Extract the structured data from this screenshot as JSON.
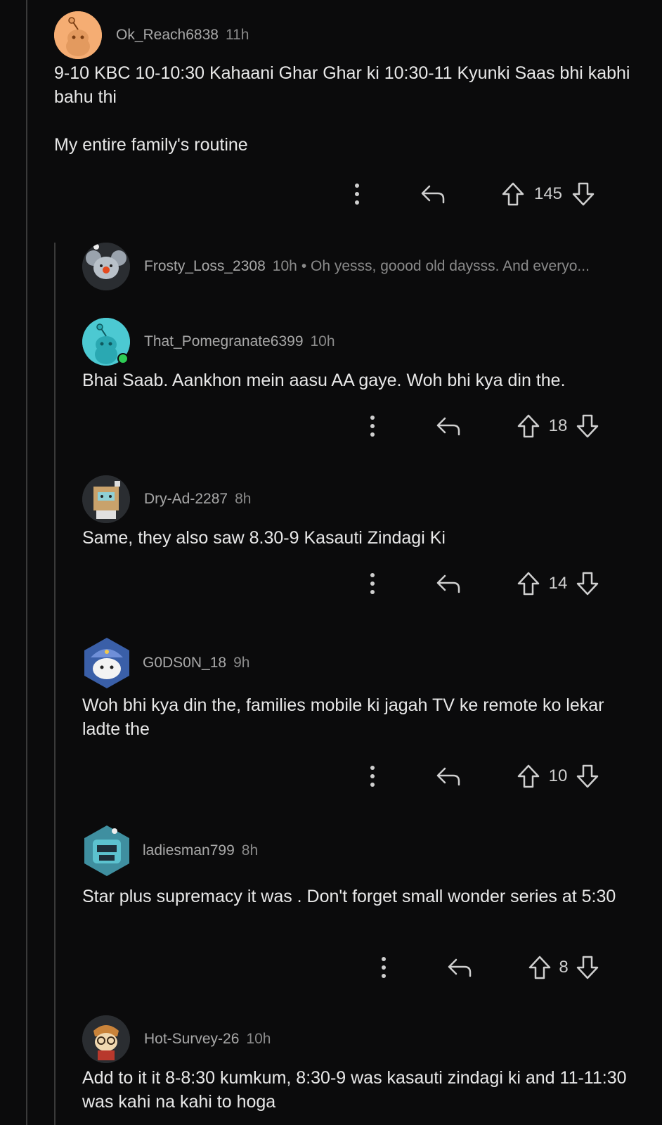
{
  "comments": [
    {
      "username": "Ok_Reach6838",
      "time": "11h",
      "body": "9-10 KBC 10-10:30 Kahaani Ghar Ghar ki 10:30-11 Kyunki Saas bhi kabhi bahu thi\n\nMy entire family's routine",
      "score": "145",
      "avatar_icon": "snoo-orange-avatar-icon"
    },
    {
      "username": "Frosty_Loss_2308",
      "time": "10h",
      "preview": "• Oh yesss, goood old daysss. And everyo...",
      "avatar_icon": "snoo-koala-avatar-icon"
    },
    {
      "username": "That_Pomegranate6399",
      "time": "10h",
      "body": "Bhai Saab. Aankhon mein aasu AA gaye. Woh bhi kya din the.",
      "score": "18",
      "avatar_icon": "snoo-teal-avatar-icon"
    },
    {
      "username": "Dry-Ad-2287",
      "time": "8h",
      "body": "Same, they also saw 8.30-9 Kasauti Zindagi Ki",
      "score": "14",
      "avatar_icon": "snoo-box-avatar-icon"
    },
    {
      "username": "G0DS0N_18",
      "time": "9h",
      "body": "Woh bhi kya din the, families mobile ki jagah TV ke remote ko lekar ladte the",
      "score": "10",
      "avatar_icon": "snoo-turban-avatar-icon"
    },
    {
      "username": "ladiesman799",
      "time": "8h",
      "body": "Star plus supremacy it was . Don't forget small wonder series at 5:30",
      "score": "8",
      "avatar_icon": "snoo-robot-avatar-icon"
    },
    {
      "username": "Hot-Survey-26",
      "time": "10h",
      "body": "Add to it it 8-8:30 kumkum, 8:30-9 was kasauti zindagi ki and 11-11:30 was kahi na kahi to hoga",
      "avatar_icon": "snoo-glasses-avatar-icon"
    }
  ],
  "icons": {
    "more": "more-options-icon",
    "reply": "reply-icon",
    "upvote": "upvote-icon",
    "downvote": "downvote-icon"
  },
  "colors": {
    "background": "#0b0b0c",
    "thread_line": "#3a3a3a",
    "online": "#2ecc55"
  }
}
